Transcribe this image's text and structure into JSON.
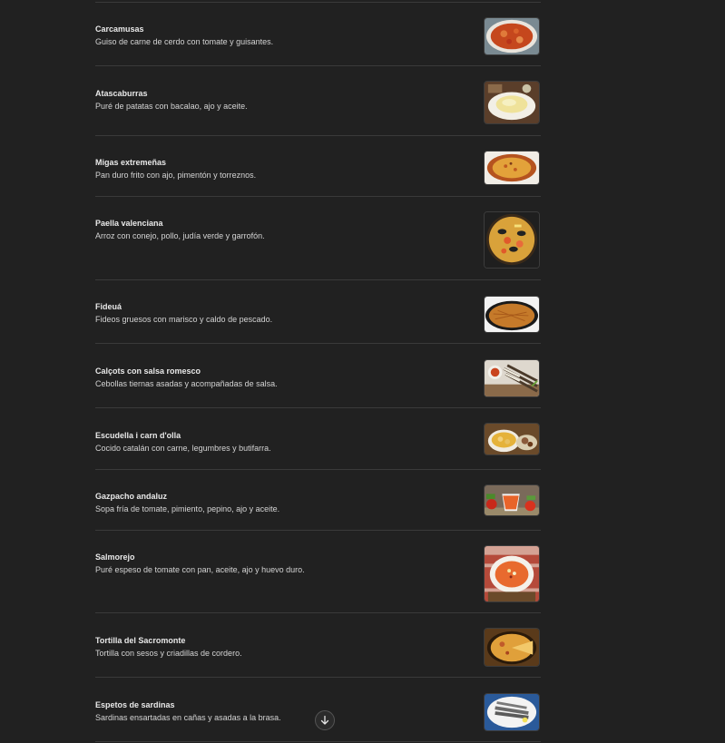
{
  "dishes": [
    {
      "name": "Carcamusas",
      "description": "Guiso de carne de cerdo con tomate y guisantes.",
      "image": "dish-photo-stew"
    },
    {
      "name": "Atascaburras",
      "description": "Puré de patatas con bacalao, ajo y aceite.",
      "image": "dish-photo-mash"
    },
    {
      "name": "Migas extremeñas",
      "description": "Pan duro frito con ajo, pimentón y torreznos.",
      "image": "dish-photo-migas"
    },
    {
      "name": "Paella valenciana",
      "description": "Arroz con conejo, pollo, judía verde y garrofón.",
      "image": "dish-photo-paella"
    },
    {
      "name": "Fideuá",
      "description": "Fideos gruesos con marisco y caldo de pescado.",
      "image": "dish-photo-fideua"
    },
    {
      "name": "Calçots con salsa romesco",
      "description": "Cebollas tiernas asadas y acompañadas de salsa.",
      "image": "dish-photo-calcots"
    },
    {
      "name": "Escudella i carn d'olla",
      "description": "Cocido catalán con carne, legumbres y butifarra.",
      "image": "dish-photo-escudella"
    },
    {
      "name": "Gazpacho andaluz",
      "description": "Sopa fría de tomate, pimiento, pepino, ajo y aceite.",
      "image": "dish-photo-gazpacho"
    },
    {
      "name": "Salmorejo",
      "description": "Puré espeso de tomate con pan, aceite, ajo y huevo duro.",
      "image": "dish-photo-salmorejo"
    },
    {
      "name": "Tortilla del Sacromonte",
      "description": "Tortilla con sesos y criadillas de cordero.",
      "image": "dish-photo-tortilla"
    },
    {
      "name": "Espetos de sardinas",
      "description": "Sardinas ensartadas en cañas y asadas a la brasa.",
      "image": "dish-photo-sardinas"
    }
  ],
  "scroll_button": {
    "icon": "arrow-down-icon"
  }
}
